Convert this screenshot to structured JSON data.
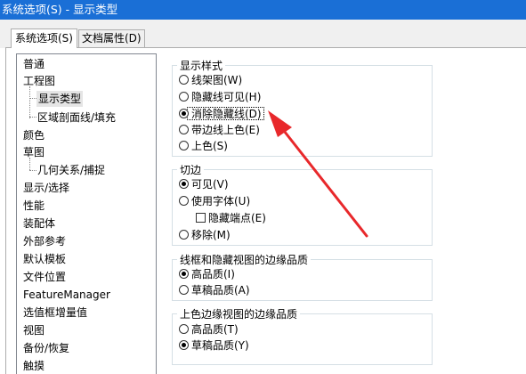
{
  "window": {
    "title": "系统选项(S) - 显示类型"
  },
  "tabs": [
    {
      "label": "系统选项(S)",
      "active": true
    },
    {
      "label": "文档属性(D)",
      "active": false
    }
  ],
  "tree": {
    "items": [
      {
        "label": "普通"
      },
      {
        "label": "工程图"
      },
      {
        "label": "显示类型",
        "selected": true
      },
      {
        "label": "区域剖面线/填充"
      },
      {
        "label": "颜色"
      },
      {
        "label": "草图"
      },
      {
        "label": "几何关系/捕捉"
      },
      {
        "label": "显示/选择"
      },
      {
        "label": "性能"
      },
      {
        "label": "装配体"
      },
      {
        "label": "外部参考"
      },
      {
        "label": "默认模板"
      },
      {
        "label": "文件位置"
      },
      {
        "label": "FeatureManager"
      },
      {
        "label": "选值框增量值"
      },
      {
        "label": "视图"
      },
      {
        "label": "备份/恢复"
      },
      {
        "label": "触摸"
      }
    ]
  },
  "display_style": {
    "legend": "显示样式",
    "options": [
      {
        "label": "线架图(W)",
        "checked": false
      },
      {
        "label": "隐藏线可见(H)",
        "checked": false
      },
      {
        "label": "消除隐藏线(D)",
        "checked": true
      },
      {
        "label": "带边线上色(E)",
        "checked": false
      },
      {
        "label": "上色(S)",
        "checked": false
      }
    ]
  },
  "tangent_edges": {
    "legend": "切边",
    "options": [
      {
        "label": "可见(V)",
        "checked": true
      },
      {
        "label": "使用字体(U)",
        "checked": false
      },
      {
        "label": "移除(M)",
        "checked": false
      }
    ],
    "hide_endpoints": {
      "label": "隐藏端点(E)",
      "checked": false
    }
  },
  "wireframe_quality": {
    "legend": "线框和隐藏视图的边缘品质",
    "options": [
      {
        "label": "高品质(I)",
        "checked": true
      },
      {
        "label": "草稿品质(A)",
        "checked": false
      }
    ]
  },
  "shaded_quality": {
    "legend": "上色边缘视图的边缘品质",
    "options": [
      {
        "label": "高品质(T)",
        "checked": false
      },
      {
        "label": "草稿品质(Y)",
        "checked": true
      }
    ]
  },
  "colors": {
    "titlebar": "#1a6fd6",
    "annotation_arrow": "#e8282b"
  }
}
